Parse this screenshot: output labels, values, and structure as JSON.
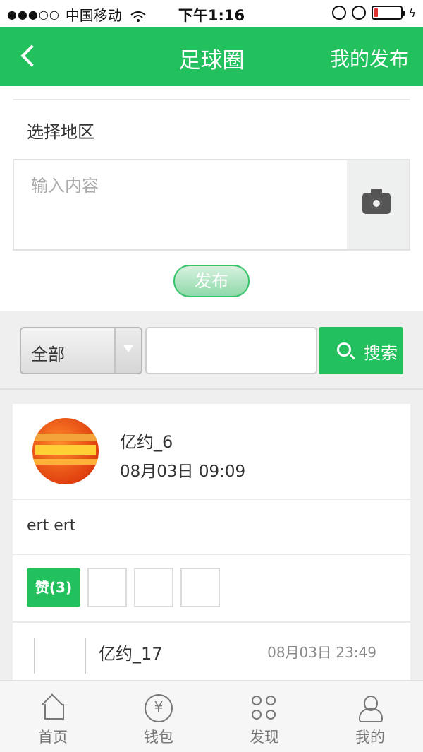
{
  "status_bar": {
    "signal_dots": "●●●○○",
    "carrier": "中国移动",
    "time": "下午1:16"
  },
  "header": {
    "title": "足球圈",
    "right_action": "我的发布"
  },
  "post_form": {
    "region_label": "选择地区",
    "input_placeholder": "输入内容",
    "publish_label": "发布"
  },
  "search": {
    "filter_value": "全部",
    "input_value": "",
    "button_label": "搜索"
  },
  "feed": {
    "post": {
      "username": "亿约_6",
      "timestamp": "08月03日 09:09",
      "content": "ert ert",
      "like_label": "赞(3)",
      "like_thumbnails": 3
    },
    "reply": {
      "username": "亿约_17",
      "timestamp": "08月03日 23:49"
    }
  },
  "tabbar": {
    "items": [
      {
        "label": "首页",
        "icon": "home-icon"
      },
      {
        "label": "钱包",
        "icon": "wallet-icon"
      },
      {
        "label": "发现",
        "icon": "discover-icon"
      },
      {
        "label": "我的",
        "icon": "profile-icon"
      }
    ]
  },
  "colors": {
    "accent": "#22c15e",
    "battery_low": "#e03030"
  }
}
